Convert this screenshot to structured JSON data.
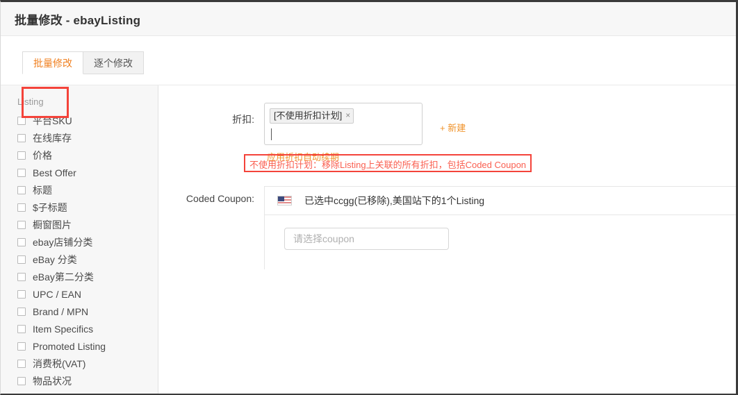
{
  "header": {
    "title": "批量修改 - ebayListing"
  },
  "tabs": [
    {
      "label": "批量修改",
      "active": true
    },
    {
      "label": "逐个修改",
      "active": false
    }
  ],
  "sidebar": {
    "group_label": "Listing",
    "items": [
      {
        "label": "平台SKU",
        "checked": false
      },
      {
        "label": "在线库存",
        "checked": false
      },
      {
        "label": "价格",
        "checked": false
      },
      {
        "label": "Best Offer",
        "checked": false
      },
      {
        "label": "标题",
        "checked": false
      },
      {
        "label": "$子标题",
        "checked": false
      },
      {
        "label": "橱窗图片",
        "checked": false
      },
      {
        "label": "ebay店铺分类",
        "checked": false
      },
      {
        "label": "eBay 分类",
        "checked": false
      },
      {
        "label": "eBay第二分类",
        "checked": false
      },
      {
        "label": "UPC / EAN",
        "checked": false
      },
      {
        "label": "Brand / MPN",
        "checked": false
      },
      {
        "label": "Item Specifics",
        "checked": false
      },
      {
        "label": "Promoted Listing",
        "checked": false
      },
      {
        "label": "消费税(VAT)",
        "checked": false
      },
      {
        "label": "物品状况",
        "checked": false
      }
    ]
  },
  "form": {
    "discount": {
      "label": "折扣:",
      "tag": "[不使用折扣计划]",
      "tag_remove": "×",
      "new_link": "+ 新建",
      "helper": "应用折扣自动续期",
      "warning": "不使用折扣计划：移除Listing上关联的所有折扣，包括Coded Coupon"
    },
    "coded_coupon": {
      "label": "Coded Coupon:",
      "site_flag": "us-flag-icon",
      "selection_text": "已选中ccgg(已移除),美国站下的1个Listing",
      "select_placeholder": "请选择coupon"
    }
  },
  "colors": {
    "accent": "#f0932b",
    "annotation": "#f4433a",
    "warning_text": "#fa5f50",
    "sidebar_bg": "#f7f7f7",
    "header_bg": "#f7f7f7"
  }
}
